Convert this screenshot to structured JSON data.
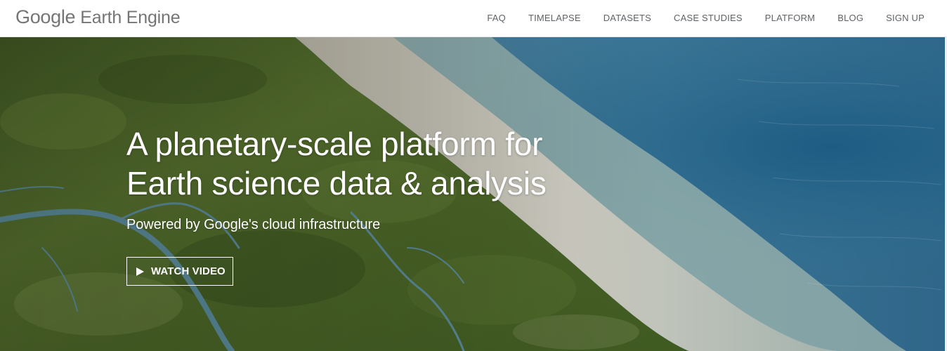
{
  "header": {
    "brand_google": "Google",
    "brand_product": "Earth Engine",
    "nav": [
      {
        "label": "FAQ"
      },
      {
        "label": "TIMELAPSE"
      },
      {
        "label": "DATASETS"
      },
      {
        "label": "CASE STUDIES"
      },
      {
        "label": "PLATFORM"
      },
      {
        "label": "BLOG"
      },
      {
        "label": "SIGN UP"
      }
    ]
  },
  "hero": {
    "title_line1": "A planetary-scale platform for",
    "title_line2": "Earth science data & analysis",
    "subtitle": "Powered by Google's cloud infrastructure",
    "watch_video_label": "WATCH VIDEO",
    "play_icon": "play-icon"
  },
  "colors": {
    "brand_text": "#757575",
    "nav_text": "#5f6368",
    "hero_text": "#ffffff",
    "land_green": "#4f6a2c",
    "beach_sand": "#cfc9bb",
    "sea_blue": "#2f6f8f"
  }
}
